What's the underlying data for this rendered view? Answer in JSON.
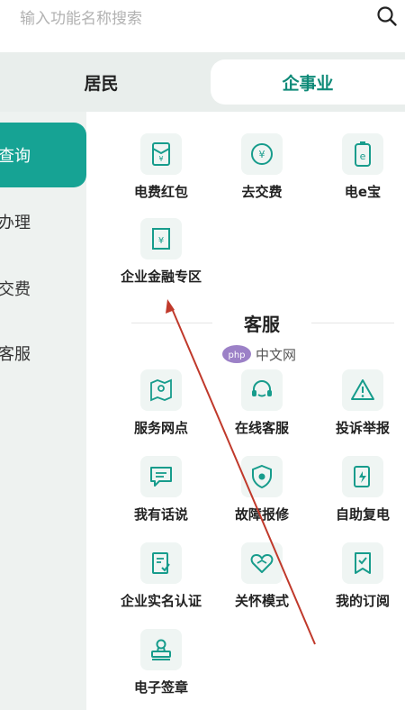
{
  "search": {
    "placeholder": "输入功能名称搜索"
  },
  "tabs": [
    {
      "label": "居民"
    },
    {
      "label": "企事业"
    }
  ],
  "sidebar": {
    "items": [
      {
        "label": "查询"
      },
      {
        "label": "办理"
      },
      {
        "label": "交费"
      },
      {
        "label": "客服"
      }
    ]
  },
  "query_section": {
    "items": [
      {
        "label": "电费红包",
        "icon": "red-packet-icon"
      },
      {
        "label": "去交费",
        "icon": "yuan-coin-icon"
      },
      {
        "label": "电e宝",
        "icon": "e-wallet-icon"
      },
      {
        "label": "企业金融专区",
        "icon": "finance-zone-icon"
      }
    ]
  },
  "service_section": {
    "title": "客服",
    "items": [
      {
        "label": "服务网点",
        "icon": "map-location-icon"
      },
      {
        "label": "在线客服",
        "icon": "headset-icon"
      },
      {
        "label": "投诉举报",
        "icon": "warning-triangle-icon"
      },
      {
        "label": "我有话说",
        "icon": "chat-bubble-icon"
      },
      {
        "label": "故障报修",
        "icon": "repair-shield-icon"
      },
      {
        "label": "自助复电",
        "icon": "power-restore-icon"
      },
      {
        "label": "企业实名认证",
        "icon": "verification-document-icon"
      },
      {
        "label": "关怀模式",
        "icon": "heart-care-icon"
      },
      {
        "label": "我的订阅",
        "icon": "bookmark-check-icon"
      },
      {
        "label": "电子签章",
        "icon": "stamp-icon"
      }
    ]
  },
  "watermark": {
    "text": "中文网",
    "logo": "php"
  },
  "colors": {
    "accent": "#16a394",
    "accent_text": "#0f8a78",
    "sidebar_bg": "#eef2f0",
    "tab_bg": "#e9eeec",
    "icon_bg": "#eff5f3"
  }
}
